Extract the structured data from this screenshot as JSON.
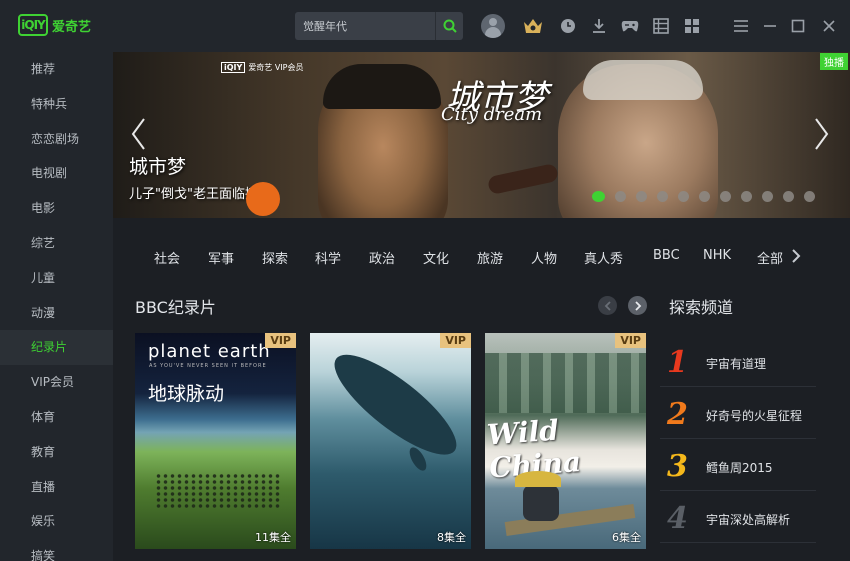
{
  "header": {
    "logo_mark": "iQIY",
    "logo_text": "爱奇艺",
    "search_value": "觉醒年代"
  },
  "sidebar": {
    "items": [
      {
        "label": "推荐"
      },
      {
        "label": "特种兵"
      },
      {
        "label": "恋恋剧场"
      },
      {
        "label": "电视剧"
      },
      {
        "label": "电影"
      },
      {
        "label": "综艺"
      },
      {
        "label": "儿童"
      },
      {
        "label": "动漫"
      },
      {
        "label": "纪录片"
      },
      {
        "label": "VIP会员"
      },
      {
        "label": "体育"
      },
      {
        "label": "教育"
      },
      {
        "label": "直播"
      },
      {
        "label": "娱乐"
      },
      {
        "label": "搞笑"
      }
    ],
    "active_index": 8
  },
  "banner": {
    "watermark_logo": "iQIY",
    "watermark_text": "爱奇艺 VIP会员",
    "art_title": "城市梦",
    "art_title_en": "City dream",
    "title": "城市梦",
    "subtitle": "儿子\"倒戈\"老王面临撤摊",
    "badge": "独播",
    "dots_total": 11,
    "active_dot": 0
  },
  "categories": [
    "社会",
    "军事",
    "探索",
    "科学",
    "政治",
    "文化",
    "旅游",
    "人物",
    "真人秀",
    "BBC",
    "NHK",
    "全部"
  ],
  "section": {
    "title": "BBC纪录片",
    "cards": [
      {
        "vip": "VIP",
        "art_en": "planet earth",
        "art_sub": "AS YOU'VE NEVER SEEN IT BEFORE",
        "art_cn": "地球脉动",
        "episodes": "11集全"
      },
      {
        "vip": "VIP",
        "episodes": "8集全"
      },
      {
        "vip": "VIP",
        "art_en": "Wild China",
        "episodes": "6集全"
      }
    ]
  },
  "right_panel": {
    "title": "探索频道",
    "items": [
      {
        "rank": "1",
        "label": "宇宙有道理",
        "color": "#e8391e"
      },
      {
        "rank": "2",
        "label": "好奇号的火星征程",
        "color": "#f07a1c"
      },
      {
        "rank": "3",
        "label": "鳕鱼周2015",
        "color": "#f5b81b"
      },
      {
        "rank": "4",
        "label": "宇宙深处高解析",
        "color": "#5a5f66"
      }
    ]
  },
  "colors": {
    "accent": "#3fd233",
    "background": "#1c1f24",
    "sidebar": "#22262c"
  }
}
